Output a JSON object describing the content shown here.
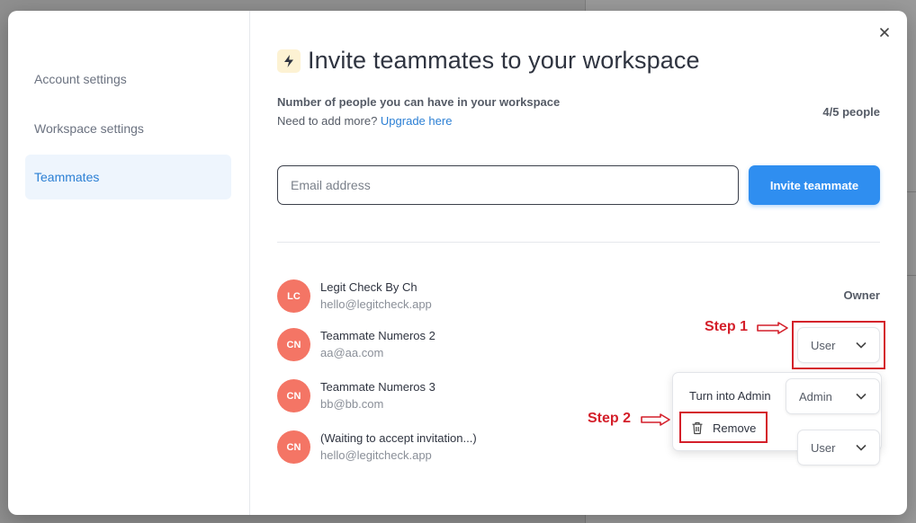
{
  "sidebar": {
    "items": [
      {
        "label": "Account settings",
        "active": false
      },
      {
        "label": "Workspace settings",
        "active": false
      },
      {
        "label": "Teammates",
        "active": true
      }
    ]
  },
  "header": {
    "title": "Invite teammates to your workspace",
    "icon": "lightning-bolt-icon"
  },
  "capacity": {
    "label": "Number of people you can have in your workspace",
    "need_more": "Need to add more?",
    "upgrade_link": "Upgrade here",
    "count": "4/5 people"
  },
  "invite": {
    "email_placeholder": "Email address",
    "email_value": "",
    "button_label": "Invite teammate"
  },
  "members": [
    {
      "initials": "LC",
      "name": "Legit Check By Ch",
      "email": "hello@legitcheck.app",
      "role": "Owner"
    },
    {
      "initials": "CN",
      "name": "Teammate Numeros 2",
      "email": "aa@aa.com",
      "role": "User"
    },
    {
      "initials": "CN",
      "name": "Teammate Numeros 3",
      "email": "bb@bb.com",
      "role": "Admin"
    },
    {
      "initials": "CN",
      "name": "(Waiting to accept invitation...)",
      "email": "hello@legitcheck.app",
      "role": "User"
    }
  ],
  "role_menu": {
    "items": [
      "Turn into Admin",
      "Remove"
    ]
  },
  "annotations": {
    "step1": "Step 1",
    "step2": "Step 2"
  },
  "colors": {
    "accent": "#2f8ef0",
    "link": "#2b7fd4",
    "avatar": "#f47565",
    "annotation": "#d41f2a",
    "sidebar_active_bg": "#eef5fd"
  }
}
